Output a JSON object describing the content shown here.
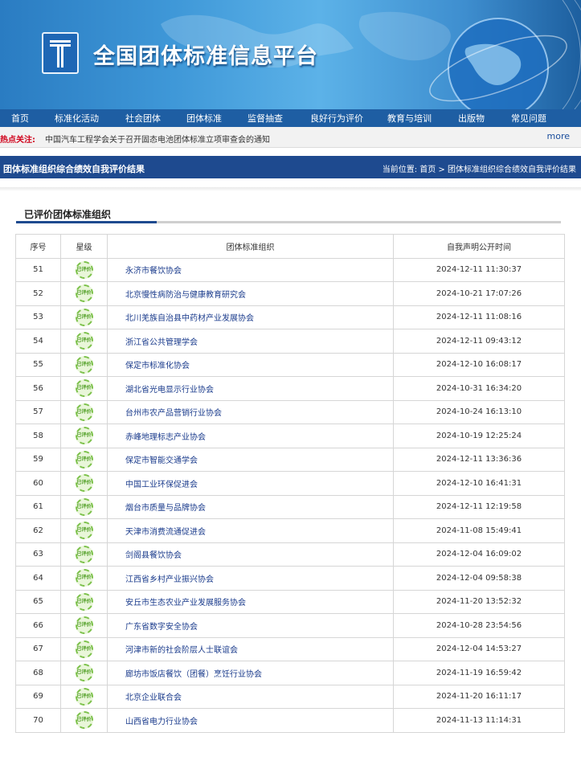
{
  "site": {
    "title": "全国团体标准信息平台"
  },
  "nav": [
    "首页",
    "标准化活动",
    "社会团体",
    "团体标准",
    "监督抽查",
    "良好行为评价",
    "教育与培训",
    "出版物",
    "常见问题"
  ],
  "hot": {
    "label": "热点关注:",
    "news": "中国汽车工程学会关于召开固态电池团体标准立项审查会的通知",
    "more": "more"
  },
  "titlebar": {
    "title": "团体标准组织综合绩效自我评价结果",
    "crumb": "当前位置: 首页 > 团体标准组织综合绩效自我评价结果"
  },
  "section": {
    "heading": "已评价团体标准组织"
  },
  "table": {
    "headers": [
      "序号",
      "星级",
      "团体标准组织",
      "自我声明公开时间"
    ],
    "badge_text": "已评价",
    "rows": [
      [
        "51",
        "永济市餐饮协会",
        "2024-12-11 11:30:37"
      ],
      [
        "52",
        "北京慢性病防治与健康教育研究会",
        "2024-10-21 17:07:26"
      ],
      [
        "53",
        "北川羌族自治县中药材产业发展协会",
        "2024-12-11 11:08:16"
      ],
      [
        "54",
        "浙江省公共管理学会",
        "2024-12-11 09:43:12"
      ],
      [
        "55",
        "保定市标准化协会",
        "2024-12-10 16:08:17"
      ],
      [
        "56",
        "湖北省光电显示行业协会",
        "2024-10-31 16:34:20"
      ],
      [
        "57",
        "台州市农产品营销行业协会",
        "2024-10-24 16:13:10"
      ],
      [
        "58",
        "赤峰地理标志产业协会",
        "2024-10-19 12:25:24"
      ],
      [
        "59",
        "保定市智能交通学会",
        "2024-12-11 13:36:36"
      ],
      [
        "60",
        "中国工业环保促进会",
        "2024-12-10 16:41:31"
      ],
      [
        "61",
        "烟台市质量与品牌协会",
        "2024-12-11 12:19:58"
      ],
      [
        "62",
        "天津市消费流通促进会",
        "2024-11-08 15:49:41"
      ],
      [
        "63",
        "剑阁县餐饮协会",
        "2024-12-04 16:09:02"
      ],
      [
        "64",
        "江西省乡村产业振兴协会",
        "2024-12-04 09:58:38"
      ],
      [
        "65",
        "安丘市生态农业产业发展服务协会",
        "2024-11-20 13:52:32"
      ],
      [
        "66",
        "广东省数字安全协会",
        "2024-10-28 23:54:56"
      ],
      [
        "67",
        "河津市新的社会阶层人士联谊会",
        "2024-12-04 14:53:27"
      ],
      [
        "68",
        "廊坊市饭店餐饮（团餐）烹饪行业协会",
        "2024-11-19 16:59:42"
      ],
      [
        "69",
        "北京企业联合会",
        "2024-11-20 16:11:17"
      ],
      [
        "70",
        "山西省电力行业协会",
        "2024-11-13 11:14:31"
      ]
    ]
  }
}
